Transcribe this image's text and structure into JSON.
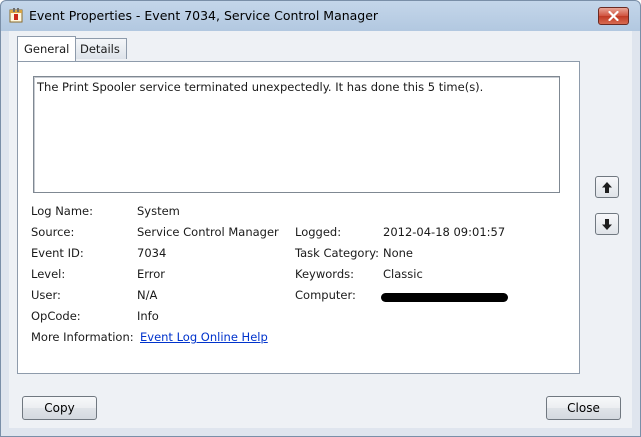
{
  "window": {
    "title": "Event Properties - Event 7034, Service Control Manager"
  },
  "tabs": [
    {
      "label": "General",
      "active": true
    },
    {
      "label": "Details",
      "active": false
    }
  ],
  "description": "The Print Spooler service terminated unexpectedly.  It has done this 5 time(s).",
  "properties": {
    "log_name": {
      "label": "Log Name:",
      "value": "System"
    },
    "source": {
      "label": "Source:",
      "value": "Service Control Manager"
    },
    "logged": {
      "label": "Logged:",
      "value": "2012-04-18 09:01:57"
    },
    "event_id": {
      "label": "Event ID:",
      "value": "7034"
    },
    "task_category": {
      "label": "Task Category:",
      "value": "None"
    },
    "level": {
      "label": "Level:",
      "value": "Error"
    },
    "keywords": {
      "label": "Keywords:",
      "value": "Classic"
    },
    "user": {
      "label": "User:",
      "value": "N/A"
    },
    "computer": {
      "label": "Computer:",
      "value": ""
    },
    "opcode": {
      "label": "OpCode:",
      "value": "Info"
    },
    "more_info": {
      "label": "More Information:",
      "link_text": "Event Log Online Help"
    }
  },
  "buttons": {
    "copy": "Copy",
    "close": "Close"
  },
  "icons": {
    "window": "event-viewer-icon",
    "close": "close-icon",
    "up": "arrow-up-icon",
    "down": "arrow-down-icon"
  },
  "colors": {
    "link": "#0033cc",
    "close_button": "#c9412b"
  }
}
